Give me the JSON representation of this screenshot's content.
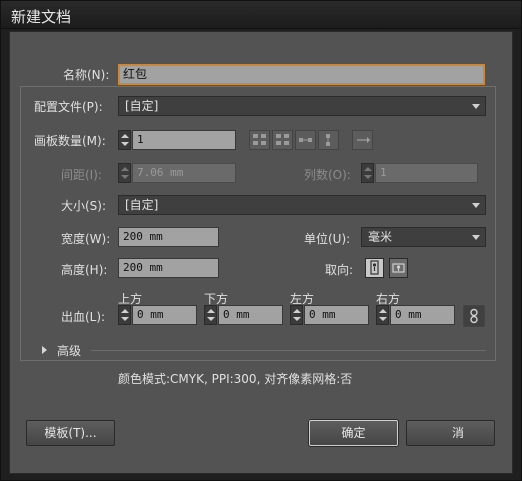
{
  "window": {
    "title": "新建文档"
  },
  "name": {
    "label": "名称(N):",
    "value": "红包"
  },
  "profile": {
    "label": "配置文件(P):",
    "value": "[自定]"
  },
  "artboards": {
    "count_label": "画板数量(M):",
    "count_value": "1",
    "spacing_label": "间距(I):",
    "spacing_value": "7.06 mm",
    "columns_label": "列数(O):",
    "columns_value": "1"
  },
  "size": {
    "label": "大小(S):",
    "value": "[自定]"
  },
  "width": {
    "label": "宽度(W):",
    "value": "200 mm"
  },
  "height": {
    "label": "高度(H):",
    "value": "200 mm"
  },
  "units": {
    "label": "单位(U):",
    "value": "毫米"
  },
  "orientation": {
    "label": "取向:"
  },
  "bleed": {
    "label": "出血(L):",
    "top_label": "上方",
    "top_value": "0 mm",
    "bottom_label": "下方",
    "bottom_value": "0 mm",
    "left_label": "左方",
    "left_value": "0 mm",
    "right_label": "右方",
    "right_value": "0 mm"
  },
  "advanced": {
    "label": "高级",
    "summary": "颜色模式:CMYK, PPI:300, 对齐像素网格:否"
  },
  "buttons": {
    "templates": "模板(T)...",
    "ok": "确定",
    "cancel": "消"
  }
}
